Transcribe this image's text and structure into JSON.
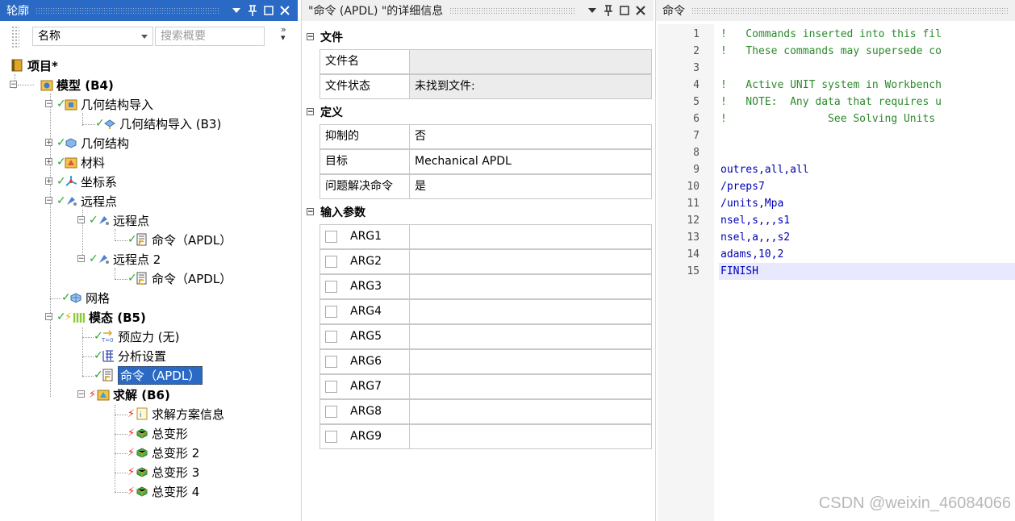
{
  "outline": {
    "title": "轮廓",
    "filter_label": "名称",
    "search_placeholder": "搜索概要",
    "tree": [
      {
        "label": "项目*",
        "bold": true
      },
      {
        "label": "模型 (B4)",
        "bold": true
      },
      {
        "label": "几何结构导入"
      },
      {
        "label": "几何结构导入 (B3)"
      },
      {
        "label": "几何结构"
      },
      {
        "label": "材料"
      },
      {
        "label": "坐标系"
      },
      {
        "label": "远程点"
      },
      {
        "label": "远程点"
      },
      {
        "label": "命令（APDL）"
      },
      {
        "label": "远程点 2"
      },
      {
        "label": "命令（APDL）"
      },
      {
        "label": "网格"
      },
      {
        "label": "模态 (B5)",
        "bold": true
      },
      {
        "label": "预应力 (无)"
      },
      {
        "label": "分析设置"
      },
      {
        "label": "命令（APDL）",
        "selected": true
      },
      {
        "label": "求解 (B6)",
        "bold": true
      },
      {
        "label": "求解方案信息"
      },
      {
        "label": "总变形"
      },
      {
        "label": "总变形 2"
      },
      {
        "label": "总变形 3"
      },
      {
        "label": "总变形 4"
      }
    ]
  },
  "details": {
    "title": "\"命令 (APDL) \"的详细信息",
    "sections": [
      {
        "title": "文件",
        "rows": [
          {
            "label": "文件名",
            "value": ""
          },
          {
            "label": "文件状态",
            "value": "未找到文件:"
          }
        ]
      },
      {
        "title": "定义",
        "rows": [
          {
            "label": "抑制的",
            "value": "否"
          },
          {
            "label": "目标",
            "value": "Mechanical APDL"
          },
          {
            "label": "问题解决命令",
            "value": "是"
          }
        ]
      },
      {
        "title": "输入参数",
        "args": [
          "ARG1",
          "ARG2",
          "ARG3",
          "ARG4",
          "ARG5",
          "ARG6",
          "ARG7",
          "ARG8",
          "ARG9"
        ]
      }
    ]
  },
  "commands": {
    "title": "命令",
    "lines": [
      {
        "n": "1",
        "text": "!   Commands inserted into this fil",
        "kind": "cmt"
      },
      {
        "n": "2",
        "text": "!   These commands may supersede co",
        "kind": "cmt"
      },
      {
        "n": "3",
        "text": "",
        "kind": "cmt"
      },
      {
        "n": "4",
        "text": "!   Active UNIT system in Workbench",
        "kind": "cmt"
      },
      {
        "n": "5",
        "text": "!   NOTE:  Any data that requires u",
        "kind": "cmt"
      },
      {
        "n": "6",
        "text": "!                See Solving Units",
        "kind": "cmt"
      },
      {
        "n": "7",
        "text": "",
        "kind": "cmt"
      },
      {
        "n": "8",
        "text": "",
        "kind": "cmt"
      },
      {
        "n": "9",
        "text": "outres,all,all",
        "kind": "cmd"
      },
      {
        "n": "10",
        "text": "/preps7",
        "kind": "cmd"
      },
      {
        "n": "11",
        "text": "/units,Mpa",
        "kind": "cmd"
      },
      {
        "n": "12",
        "text": "nsel,s,,,s1",
        "kind": "cmd"
      },
      {
        "n": "13",
        "text": "nsel,a,,,s2",
        "kind": "cmd"
      },
      {
        "n": "14",
        "text": "adams,10,2",
        "kind": "cmd"
      },
      {
        "n": "15",
        "text": "FINISH",
        "kind": "cmd",
        "current": true
      }
    ]
  },
  "watermark": "CSDN @weixin_46084066"
}
